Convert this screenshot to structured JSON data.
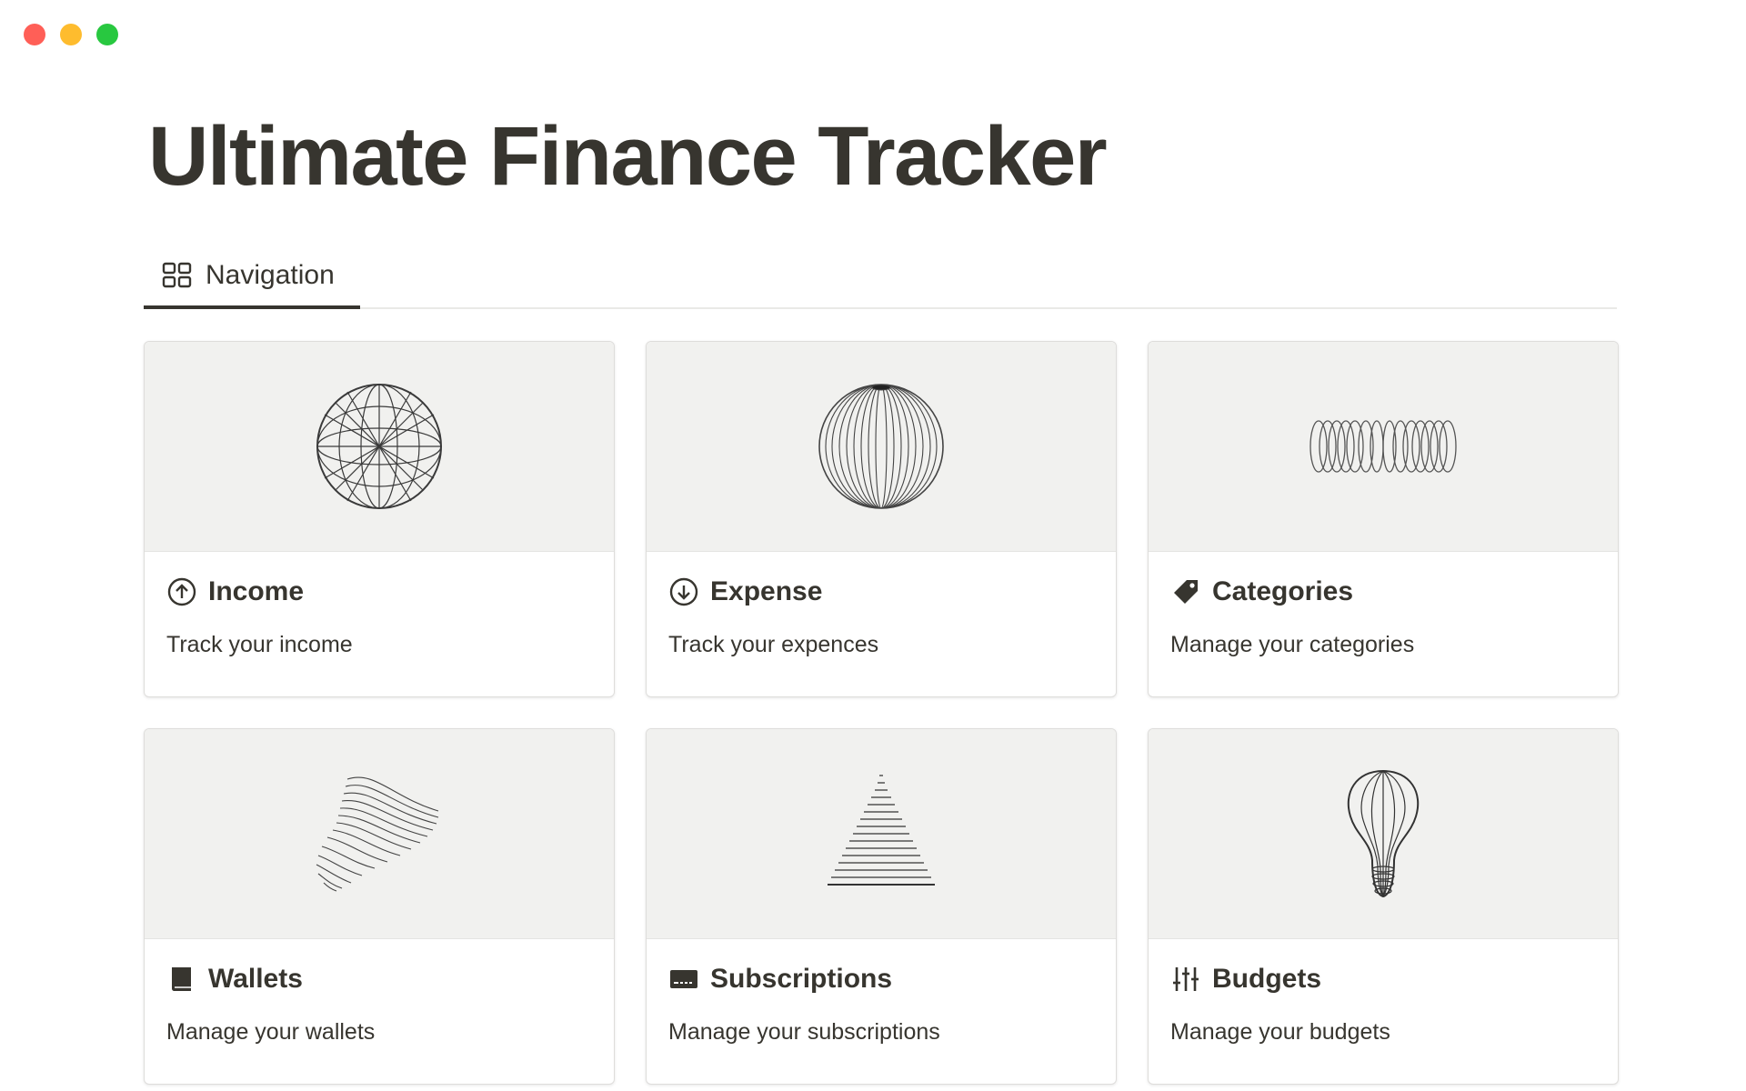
{
  "window": {
    "controls": [
      "close",
      "minimize",
      "zoom"
    ]
  },
  "page": {
    "title": "Ultimate Finance Tracker"
  },
  "tabs": [
    {
      "label": "Navigation",
      "icon": "gallery-grid-icon",
      "active": true
    }
  ],
  "cards": [
    {
      "title": "Income",
      "description": "Track your income",
      "icon": "arrow-up-circle-icon",
      "cover": "geodesic-sphere-illustration"
    },
    {
      "title": "Expense",
      "description": "Track your expences",
      "icon": "arrow-down-circle-icon",
      "cover": "striped-sphere-illustration"
    },
    {
      "title": "Categories",
      "description": "Manage your categories",
      "icon": "tag-icon",
      "cover": "coil-rings-illustration"
    },
    {
      "title": "Wallets",
      "description": "Manage your wallets",
      "icon": "book-icon",
      "cover": "wave-ribbon-illustration"
    },
    {
      "title": "Subscriptions",
      "description": "Manage your subscriptions",
      "icon": "credit-card-icon",
      "cover": "line-pyramid-illustration"
    },
    {
      "title": "Budgets",
      "description": "Manage your budgets",
      "icon": "sliders-icon",
      "cover": "lightbulb-wire-illustration"
    }
  ],
  "colors": {
    "text": "#37352f",
    "cover_bg": "#f1f1ef",
    "border": "#dedddb",
    "close": "#ff5f57",
    "minimize": "#febc2e",
    "zoom": "#28c840"
  }
}
